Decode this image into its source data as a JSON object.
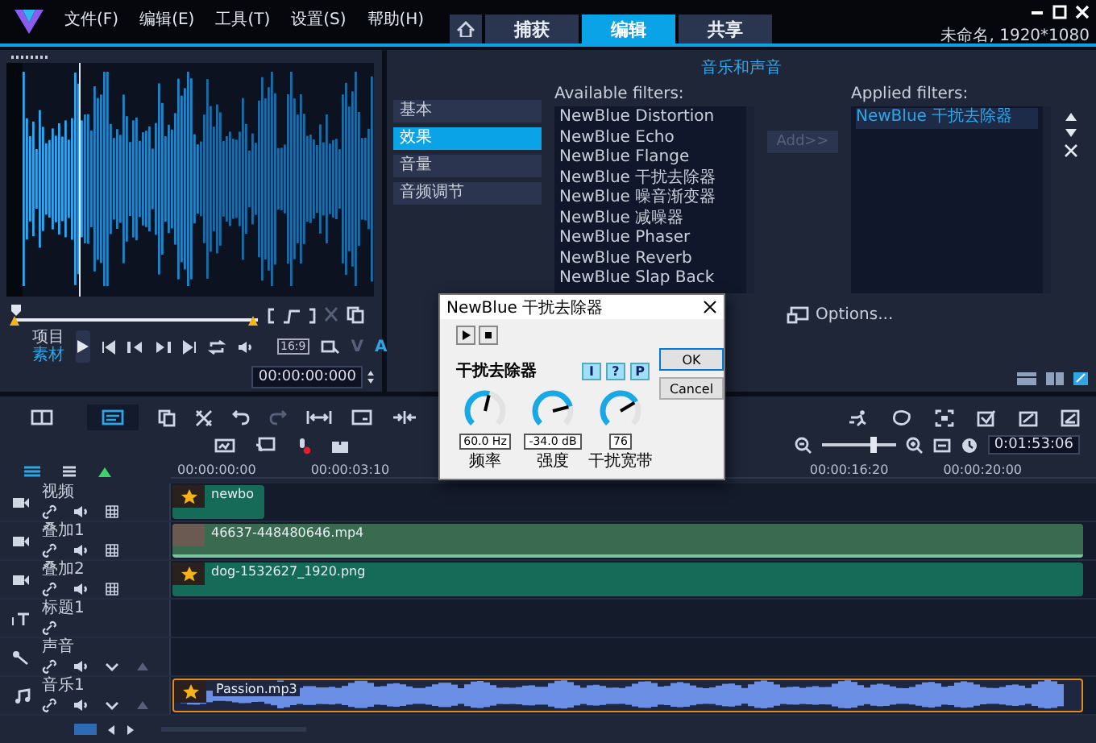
{
  "app": {
    "menus": [
      "文件(F)",
      "编辑(E)",
      "工具(T)",
      "设置(S)",
      "帮助(H)"
    ],
    "tabs": [
      {
        "label": "捕获",
        "selected": false
      },
      {
        "label": "编辑",
        "selected": true
      },
      {
        "label": "共享",
        "selected": false
      }
    ],
    "project_info": "未命名, 1920*1080"
  },
  "preview": {
    "modes": [
      {
        "label": "项目",
        "selected": false
      },
      {
        "label": "素材",
        "selected": true
      }
    ],
    "aspect": "16:9",
    "timecode": "00:00:00:000",
    "track_toggles": [
      {
        "label": "V",
        "selected": false
      },
      {
        "label": "A",
        "selected": true
      }
    ]
  },
  "options_panel": {
    "title": "音乐和声音",
    "categories": [
      {
        "label": "基本",
        "selected": false
      },
      {
        "label": "效果",
        "selected": true
      },
      {
        "label": "音量",
        "selected": false
      },
      {
        "label": "音频调节",
        "selected": false
      }
    ],
    "available_label": "Available filters:",
    "available_filters": [
      "NewBlue Distortion",
      "NewBlue Echo",
      "NewBlue Flange",
      "NewBlue 干扰去除器",
      "NewBlue 噪音渐变器",
      "NewBlue 减噪器",
      "NewBlue Phaser",
      "NewBlue Reverb",
      "NewBlue Slap Back"
    ],
    "add_button": {
      "label": "Add>>",
      "disabled": true
    },
    "applied_label": "Applied filters:",
    "applied_filters": [
      {
        "label": "NewBlue 干扰去除器",
        "selected": true
      }
    ],
    "options_link": "Options..."
  },
  "toolbar": {
    "view_buttons": [
      {
        "selected": false
      },
      {
        "selected": true
      }
    ],
    "zoom": {
      "level": 0.7
    },
    "timecode": "0:01:53:06"
  },
  "ruler": {
    "labels_left": [
      "00:00:00:00",
      "00:00:03:10"
    ],
    "labels_right": [
      "00:00:16:20",
      "00:00:20:00"
    ]
  },
  "tracks": [
    {
      "name": "视频",
      "kind": "video",
      "clips": [
        {
          "name": "newbo",
          "kind": "video",
          "starred": true
        }
      ]
    },
    {
      "name": "叠加1",
      "kind": "overlay",
      "clips": [
        {
          "name": "46637-448480646.mp4",
          "kind": "video",
          "starred": false
        }
      ]
    },
    {
      "name": "叠加2",
      "kind": "overlay",
      "clips": [
        {
          "name": "dog-1532627_1920.png",
          "kind": "image",
          "starred": true
        }
      ]
    },
    {
      "name": "标题1",
      "kind": "title"
    },
    {
      "name": "声音",
      "kind": "voice"
    },
    {
      "name": "音乐1",
      "kind": "music",
      "clips": [
        {
          "name": "Passion.mp3",
          "kind": "audio",
          "starred": true
        }
      ]
    }
  ],
  "dialog": {
    "title": "NewBlue 干扰去除器",
    "heading": "干扰去除器",
    "tool_buttons": [
      "I",
      "?",
      "P"
    ],
    "ok": "OK",
    "cancel": "Cancel",
    "knobs": [
      {
        "value": "60.0 Hz",
        "label": "频率",
        "level": 0.55
      },
      {
        "value": "-34.0 dB",
        "label": "强度",
        "level": 0.78
      },
      {
        "value": "76",
        "label": "干扰宽带",
        "level": 0.72
      }
    ]
  }
}
